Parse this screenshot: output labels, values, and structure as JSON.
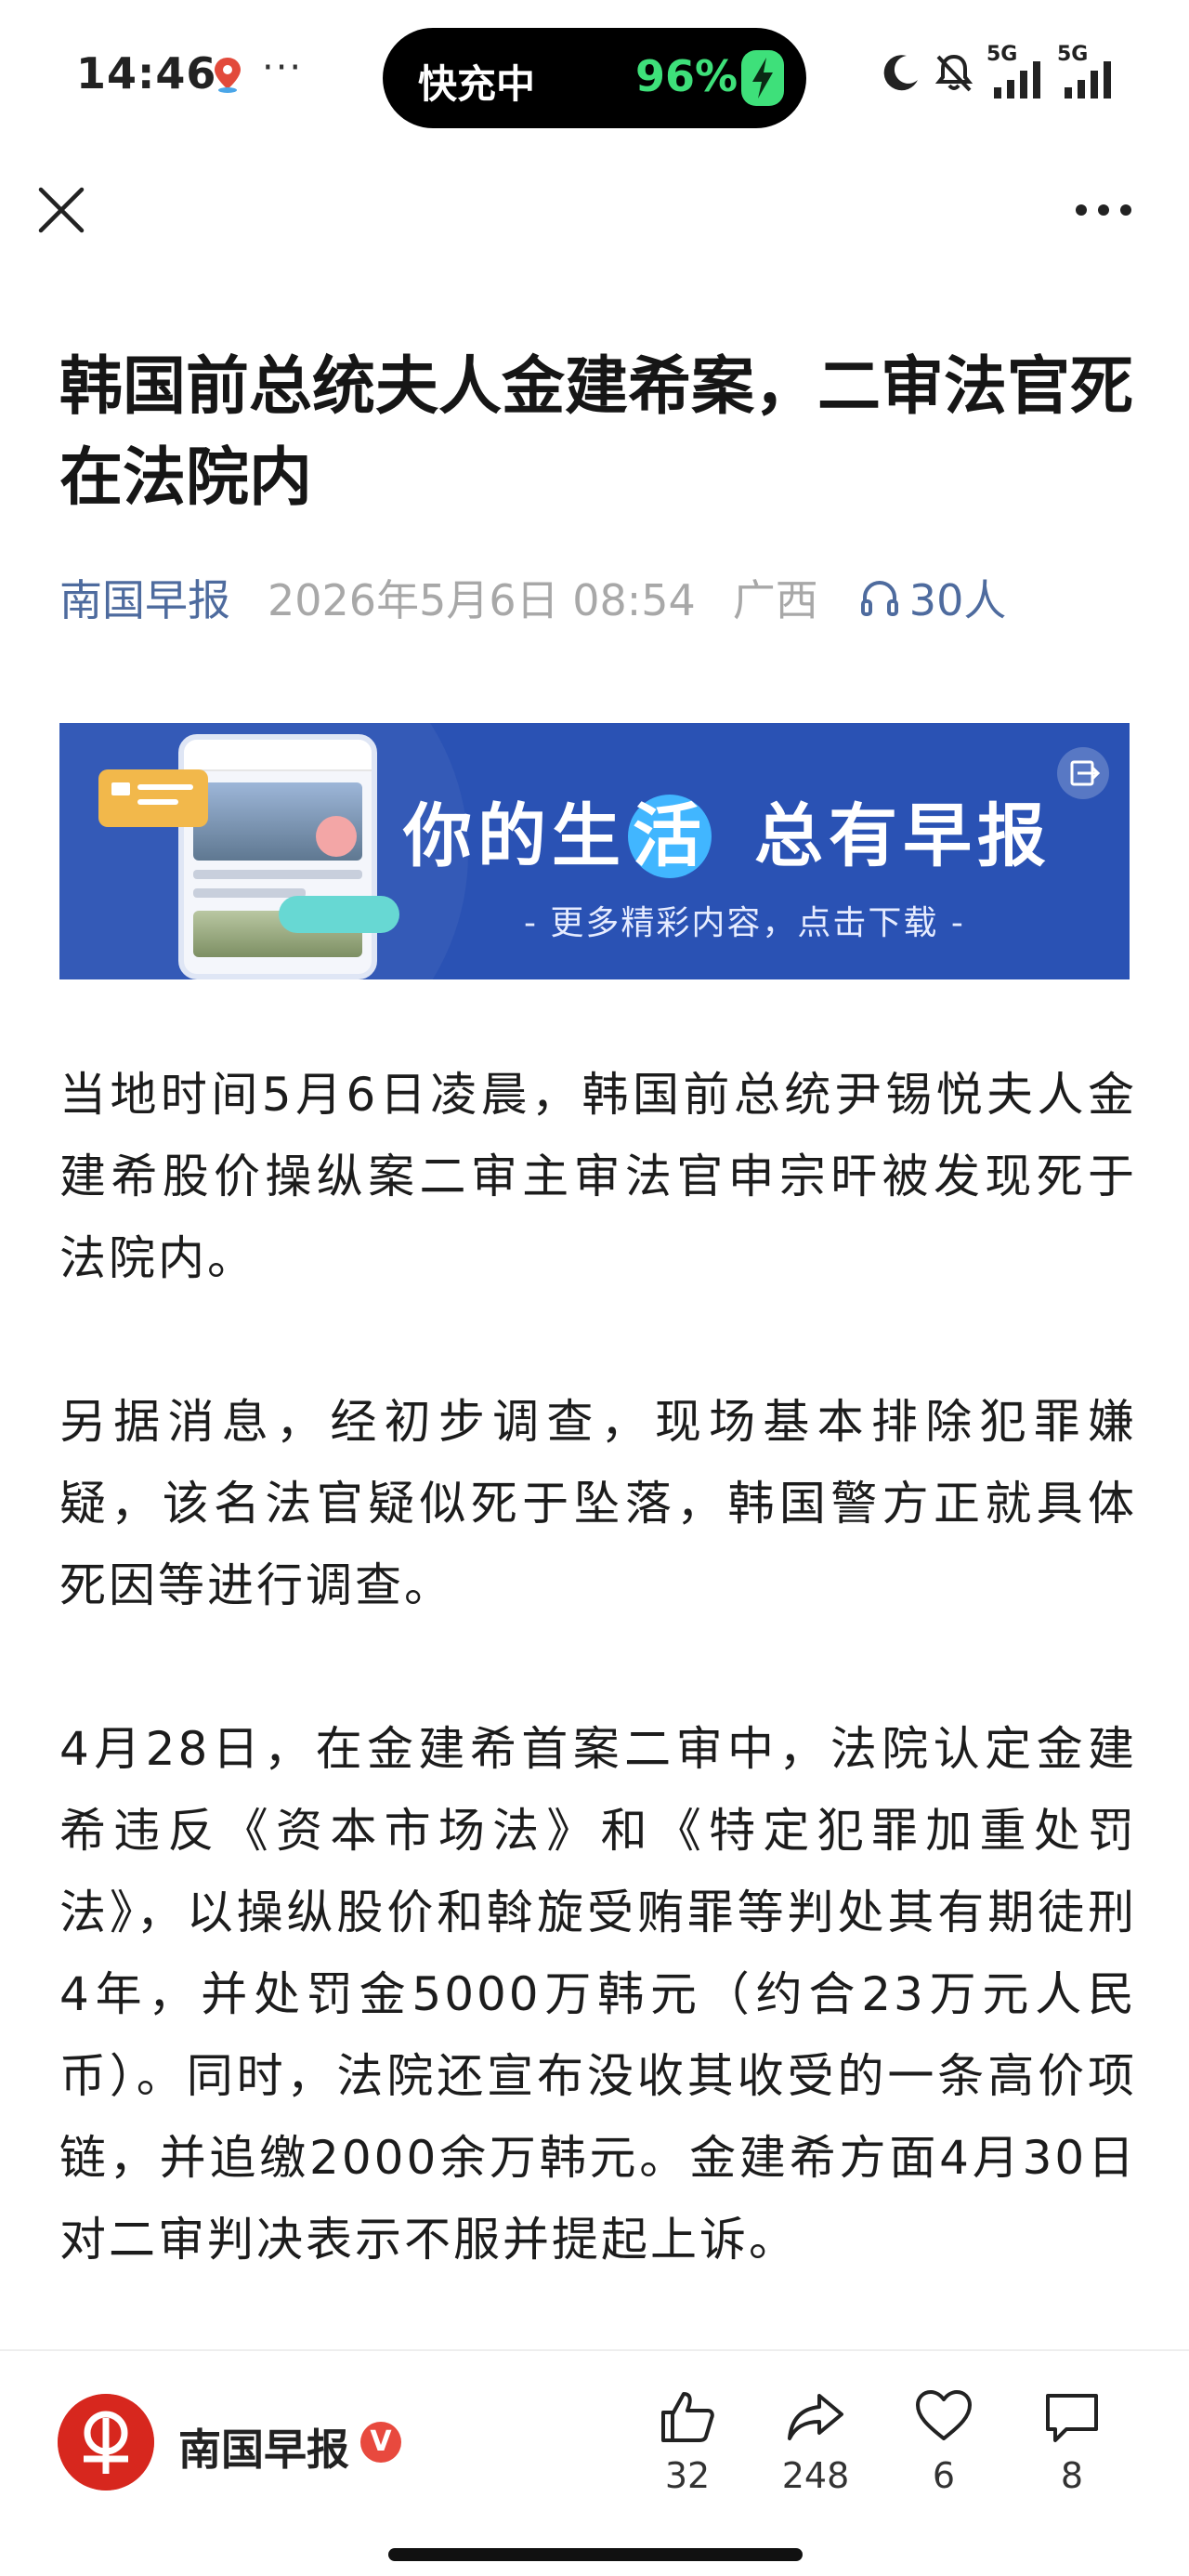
{
  "status_bar": {
    "time": "14:46",
    "dots": "···",
    "charging_label": "快充中",
    "battery": "96%",
    "signal_label_1": "5G",
    "signal_label_2": "5G"
  },
  "article": {
    "title": "韩国前总统夫人金建希案，二审法官死在法院内",
    "source": "南国早报",
    "date": "2026年5月6日 08:54",
    "region": "广西",
    "listeners": "30人"
  },
  "banner": {
    "slogan_pre": "你的生",
    "slogan_hl": "活",
    "slogan_post": "总有早报",
    "subtitle": "- 更多精彩内容，点击下载 -"
  },
  "body": {
    "paragraphs": [
      "当地时间5月6日凌晨，韩国前总统尹锡悦夫人金建希股价操纵案二审主审法官申宗旰被发现死于法院内。",
      "另据消息，经初步调查，现场基本排除犯罪嫌疑，该名法官疑似死于坠落，韩国警方正就具体死因等进行调查。",
      "4月28日，在金建希首案二审中，法院认定金建希违反《资本市场法》和《特定犯罪加重处罚法》，以操纵股价和斡旋受贿罪等判处其有期徒刑4年，并处罚金5000万韩元（约合23万元人民币）。同时，法院还宣布没收其收受的一条高价项链，并追缴2000余万韩元。金建希方面4月30日对二审判决表示不服并提起上诉。"
    ]
  },
  "bottom_bar": {
    "publisher": "南国早报",
    "verified_badge": "V",
    "like_count": "32",
    "share_count": "248",
    "favorite_count": "6",
    "comment_count": "8"
  },
  "colors": {
    "source_blue": "#4e6b9e",
    "banner_blue": "#2a52b4",
    "battery_green": "#3ee07a",
    "logo_red": "#d7271e"
  },
  "icons": [
    "location-icon",
    "bolt-icon",
    "moon-icon",
    "mute-icon",
    "signal-icon",
    "close-icon",
    "more-icon",
    "headphones-icon",
    "exit-icon",
    "like-icon",
    "share-icon",
    "heart-icon",
    "comment-icon"
  ]
}
